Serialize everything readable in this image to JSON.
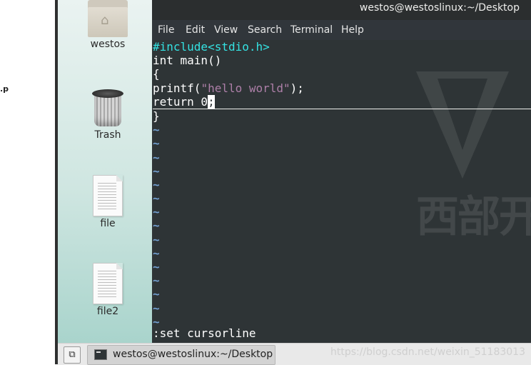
{
  "left_fragment": ".p",
  "desktop": {
    "icons": [
      {
        "label": "westos",
        "icon": "home-folder-icon"
      },
      {
        "label": "Trash",
        "icon": "trash-icon"
      },
      {
        "label": "file",
        "icon": "text-file-icon"
      },
      {
        "label": "file2",
        "icon": "text-file-icon"
      }
    ]
  },
  "terminal": {
    "title": "westos@westoslinux:~/Desktop",
    "menu": [
      "File",
      "Edit",
      "View",
      "Search",
      "Terminal",
      "Help"
    ],
    "code": {
      "line1": "#include<stdio.h>",
      "line2": "int main()",
      "line3": "{",
      "line4_pre": "printf(",
      "line4_str": "\"hello world\"",
      "line4_post": ");",
      "line5_text": "return 0",
      "line5_cursor": ";",
      "line6": "}"
    },
    "tilde": "~",
    "command_line": ":set cursorline",
    "watermark_text": "西部开"
  },
  "taskbar": {
    "show_desktop_icon": "show-desktop-icon",
    "task_label": "westos@westoslinux:~/Desktop",
    "watermark": "https://blog.csdn.net/weixin_51183013"
  },
  "colors": {
    "terminal_bg": "#2e3436",
    "preprocessor": "#34e2e2",
    "string": "#ad7fa8",
    "tilde": "#729fcf"
  }
}
